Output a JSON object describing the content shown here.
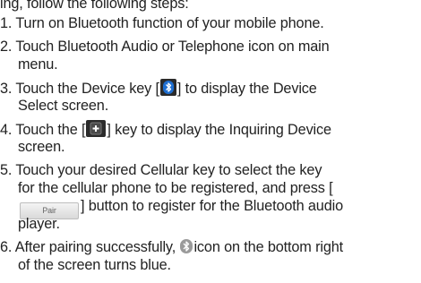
{
  "document": {
    "lines": [
      "ing, follow the following steps:",
      "1. Turn on Bluetooth function of your mobile phone.",
      "2. Touch Bluetooth Audio or Telephone icon on main",
      "menu.",
      "3. Touch the Device key [",
      "] to display the Device",
      "Select screen.",
      "4. Touch the [",
      "] key to display the Inquiring Device",
      "screen.",
      "5. Touch your desired Cellular key to select the key",
      "for the cellular phone to be registered, and press [",
      "] button to register for the Bluetooth audio",
      "player.",
      "6. After pairing successfully,",
      "icon on the bottom right",
      "of the screen turns blue."
    ],
    "pair_button_label": "Pair",
    "colors": {
      "text": "#222222",
      "bluetooth_blue": "#1f6fd1",
      "key_dark": "#2b2b2b"
    }
  }
}
